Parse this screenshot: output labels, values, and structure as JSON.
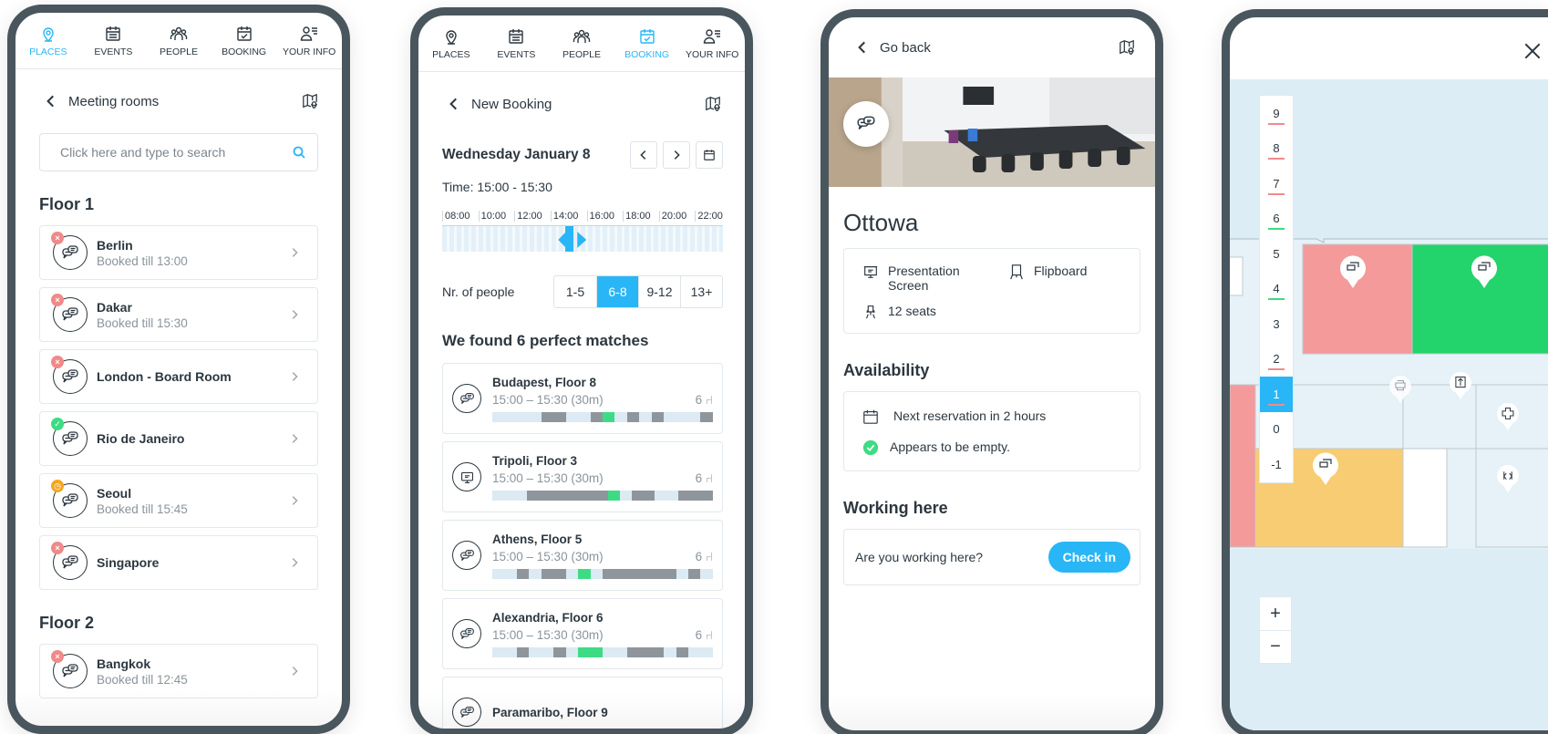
{
  "tabs": [
    {
      "label": "PLACES",
      "icon": "location-pin-icon"
    },
    {
      "label": "EVENTS",
      "icon": "calendar-list-icon"
    },
    {
      "label": "PEOPLE",
      "icon": "people-icon"
    },
    {
      "label": "BOOKING",
      "icon": "calendar-check-icon"
    },
    {
      "label": "YOUR INFO",
      "icon": "user-info-icon"
    }
  ],
  "colors": {
    "accent": "#29b6f6",
    "busy": "#f08a8a",
    "free": "#3ddc84",
    "warn": "#f5a623",
    "text": "#2c3740"
  },
  "screen1": {
    "active_tab": "PLACES",
    "back_label": "Meeting rooms",
    "search_placeholder": "Click here and type to search",
    "floors": [
      {
        "title": "Floor 1",
        "rooms": [
          {
            "name": "Berlin",
            "sub": "Booked till 13:00",
            "status": "busy"
          },
          {
            "name": "Dakar",
            "sub": "Booked till 15:30",
            "status": "busy"
          },
          {
            "name": "London - Board Room",
            "sub": "",
            "status": "busy"
          },
          {
            "name": "Rio de Janeiro",
            "sub": "",
            "status": "free"
          },
          {
            "name": "Seoul",
            "sub": "Booked till 15:45",
            "status": "warn"
          },
          {
            "name": "Singapore",
            "sub": "",
            "status": "busy"
          }
        ]
      },
      {
        "title": "Floor 2",
        "rooms": [
          {
            "name": "Bangkok",
            "sub": "Booked till 12:45",
            "status": "busy"
          }
        ]
      }
    ]
  },
  "screen2": {
    "active_tab": "BOOKING",
    "back_label": "New Booking",
    "date": "Wednesday January 8",
    "time": "Time: 15:00 - 15:30",
    "timeline_labels": [
      "08:00",
      "10:00",
      "12:00",
      "14:00",
      "16:00",
      "18:00",
      "20:00",
      "22:00"
    ],
    "selected_start_fraction": 0.46,
    "people_label": "Nr. of people",
    "people_options": [
      "1-5",
      "6-8",
      "9-12",
      "13+"
    ],
    "people_selected": "6-8",
    "matches_title": "We found 6 perfect matches",
    "matches": [
      {
        "name": "Budapest, Floor 8",
        "time": "15:00 – 15:30 (30m)",
        "seats": "6",
        "icon": "meeting-chat-icon"
      },
      {
        "name": "Tripoli, Floor 3",
        "time": "15:00 – 15:30 (30m)",
        "seats": "6",
        "icon": "presentation-screen-icon"
      },
      {
        "name": "Athens, Floor 5",
        "time": "15:00 – 15:30 (30m)",
        "seats": "6",
        "icon": "meeting-chat-icon"
      },
      {
        "name": "Alexandria, Floor 6",
        "time": "15:00 – 15:30 (30m)",
        "seats": "6",
        "icon": "meeting-chat-icon"
      },
      {
        "name": "Paramaribo, Floor 9",
        "time": "",
        "seats": "",
        "icon": "meeting-chat-icon"
      }
    ]
  },
  "screen3": {
    "back_label": "Go back",
    "room_name": "Ottowa",
    "features": [
      "Presentation Screen",
      "Flipboard",
      "12 seats"
    ],
    "availability_title": "Availability",
    "next_reservation": "Next reservation in 2 hours",
    "empty_status": "Appears to be empty.",
    "working_title": "Working here",
    "working_question": "Are you working here?",
    "checkin_label": "Check in"
  },
  "screen4": {
    "floors": [
      "9",
      "8",
      "7",
      "6",
      "5",
      "4",
      "3",
      "2",
      "1",
      "0",
      "-1"
    ],
    "selected_floor": "1",
    "zoom_in": "+",
    "zoom_out": "−"
  }
}
